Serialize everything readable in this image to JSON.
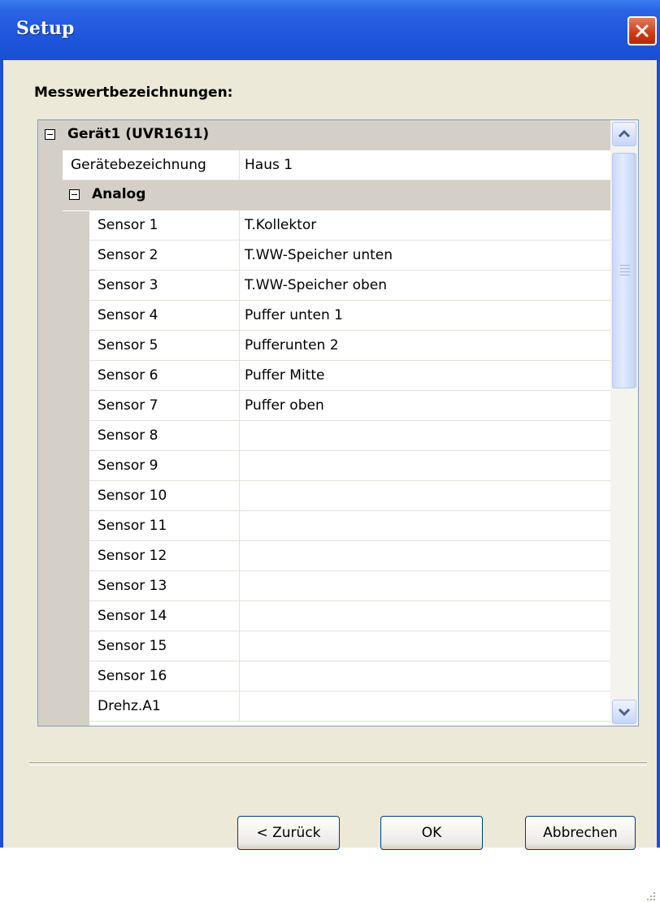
{
  "window": {
    "title": "Setup"
  },
  "heading": "Messwertbezeichnungen:",
  "device": {
    "label": "Gerät1 (UVR1611)",
    "name_key": "Gerätebezeichnung",
    "name_value": "Haus 1"
  },
  "analog": {
    "label": "Analog",
    "rows": [
      {
        "key": "Sensor 1",
        "value": "T.Kollektor"
      },
      {
        "key": "Sensor 2",
        "value": "T.WW-Speicher unten"
      },
      {
        "key": "Sensor 3",
        "value": "T.WW-Speicher oben"
      },
      {
        "key": "Sensor 4",
        "value": "Puffer unten 1"
      },
      {
        "key": "Sensor 5",
        "value": "Pufferunten 2"
      },
      {
        "key": "Sensor 6",
        "value": "Puffer Mitte"
      },
      {
        "key": "Sensor 7",
        "value": "Puffer oben"
      },
      {
        "key": "Sensor 8",
        "value": ""
      },
      {
        "key": "Sensor 9",
        "value": ""
      },
      {
        "key": "Sensor 10",
        "value": ""
      },
      {
        "key": "Sensor 11",
        "value": ""
      },
      {
        "key": "Sensor 12",
        "value": ""
      },
      {
        "key": "Sensor 13",
        "value": ""
      },
      {
        "key": "Sensor 14",
        "value": ""
      },
      {
        "key": "Sensor 15",
        "value": ""
      },
      {
        "key": "Sensor 16",
        "value": ""
      },
      {
        "key": "Drehz.A1",
        "value": ""
      }
    ]
  },
  "buttons": {
    "back": "< Zurück",
    "ok": "OK",
    "cancel": "Abbrechen"
  },
  "icons": {
    "close": "close-icon",
    "collapse": "minus-box-icon",
    "scroll_up": "chevron-up-icon",
    "scroll_down": "chevron-down-icon"
  },
  "colors": {
    "titlebar": "#2a63e6",
    "close_button": "#cf3a14",
    "dialog_bg": "#ece9d8",
    "group_bg": "#d4d0c8"
  }
}
